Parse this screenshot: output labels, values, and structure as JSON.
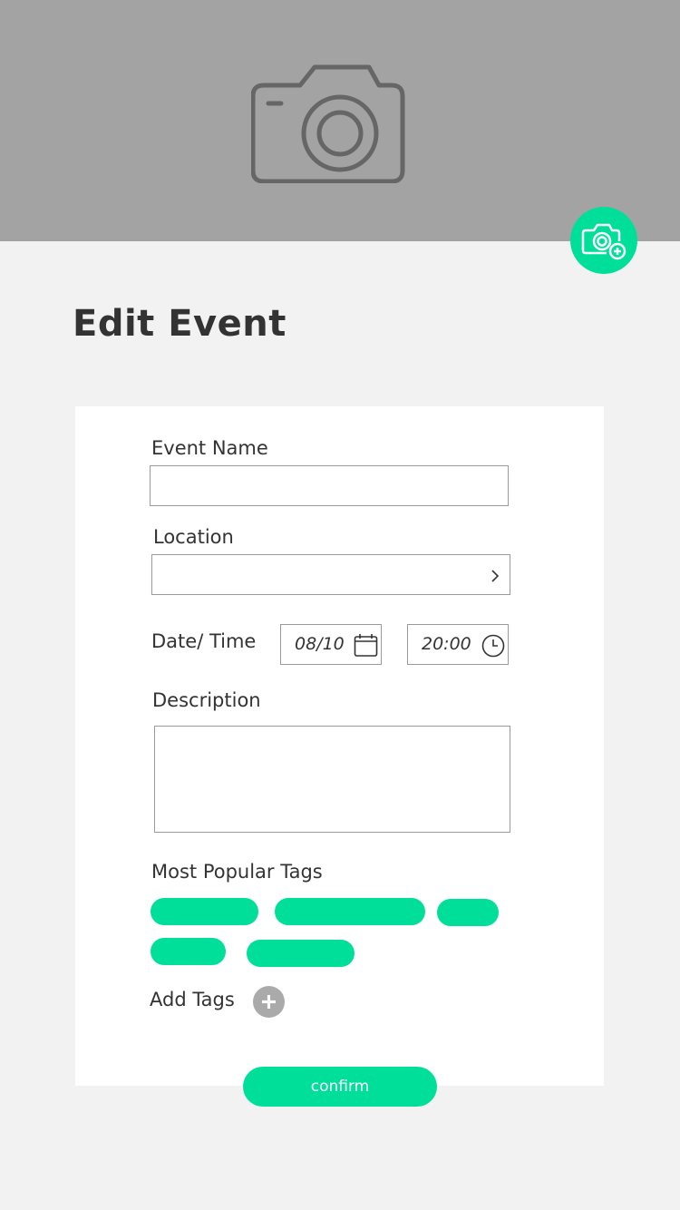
{
  "header": {
    "cover_icon": "camera-icon",
    "add_photo_icon": "camera-add-icon"
  },
  "page": {
    "title": "Edit Event"
  },
  "form": {
    "event_name": {
      "label": "Event Name",
      "value": ""
    },
    "location": {
      "label": "Location",
      "value": "",
      "chevron_icon": "chevron-right-icon"
    },
    "datetime": {
      "label": "Date/ Time",
      "date": "08/10",
      "time": "20:00",
      "date_icon": "calendar-icon",
      "time_icon": "clock-icon"
    },
    "description": {
      "label": "Description",
      "value": ""
    },
    "tags": {
      "label": "Most Popular Tags",
      "add_label": "Add Tags",
      "add_icon": "plus-icon",
      "items": [
        "",
        "",
        "",
        "",
        ""
      ]
    },
    "confirm_label": "confirm"
  },
  "colors": {
    "accent": "#00df99",
    "hero_bg": "#a3a3a3",
    "page_bg": "#f2f2f2",
    "card_bg": "#ffffff",
    "text": "#333333"
  }
}
